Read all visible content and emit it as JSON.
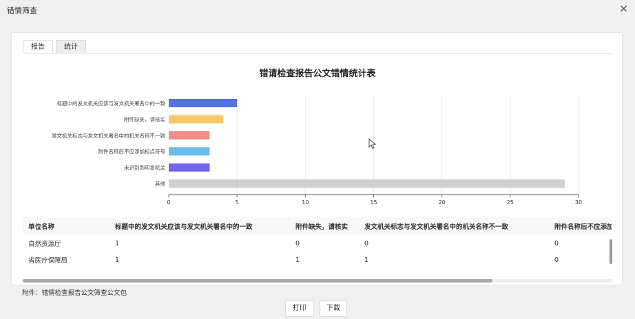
{
  "window": {
    "title": "错情筛查"
  },
  "tabs": [
    {
      "label": "报告",
      "active": true
    },
    {
      "label": "统计",
      "active": false
    }
  ],
  "chart_data": {
    "type": "bar",
    "orientation": "horizontal",
    "title": "错请检查报告公文错情统计表",
    "categories": [
      "标题中的发文机关应该与发文机关署名中的一致",
      "附件缺失，请核实",
      "发文机关标志与发文机关署名中的机关名称不一致",
      "附件名称后不应添加标点符号",
      "未识别到印发机关",
      "其他"
    ],
    "values": [
      5,
      4,
      3,
      3,
      3,
      29
    ],
    "colors": [
      "#5470e6",
      "#f9c86a",
      "#f38b86",
      "#6cbdec",
      "#7265e6",
      "#d0d0d0"
    ],
    "xlim": [
      0,
      30
    ],
    "xticks": [
      0,
      5,
      10,
      15,
      20,
      25,
      30
    ],
    "grid": true
  },
  "table": {
    "columns": [
      "单位名称",
      "标题中的发文机关应该与发文机关署名中的一致",
      "附件缺失，请核实",
      "发文机关标志与发文机关署名中的机关名称不一致",
      "附件名称后不应添加标点符号"
    ],
    "rows": [
      [
        "自然资源厅",
        "1",
        "0",
        "0",
        "0"
      ],
      [
        "省医疗保障局",
        "1",
        "1",
        "1",
        "0"
      ]
    ]
  },
  "attachment": "附件：错情检查报告公文筛查公文包",
  "buttons": {
    "print": "打印",
    "download": "下载"
  }
}
